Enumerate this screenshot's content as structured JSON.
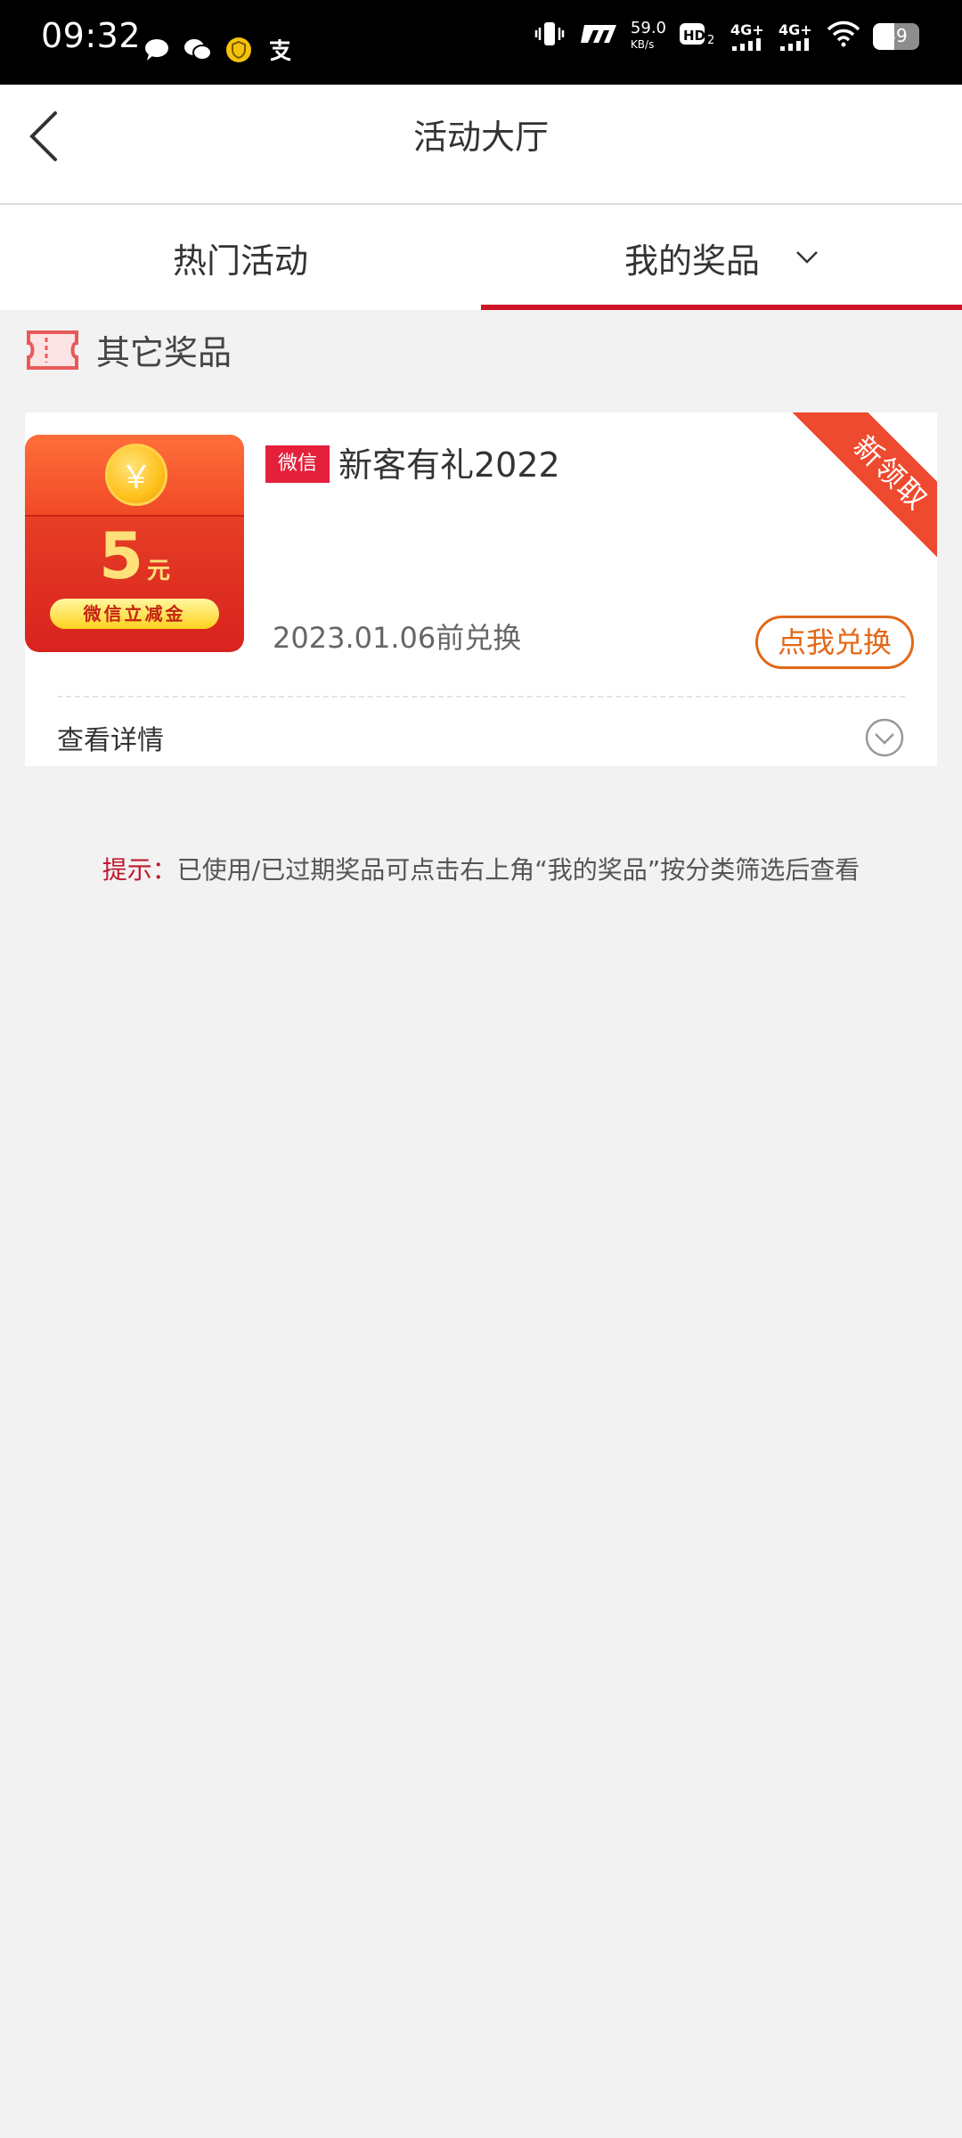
{
  "status_bar": {
    "time": "09:32",
    "speed_value": "59.0",
    "speed_unit": "KB/s",
    "network_1": "4G+",
    "network_2": "4G+",
    "battery": "49"
  },
  "header": {
    "title": "活动大厅"
  },
  "tabs": [
    {
      "label": "热门活动",
      "active": false
    },
    {
      "label": "我的奖品",
      "active": true
    }
  ],
  "section": {
    "title": "其它奖品"
  },
  "prize": {
    "coin_symbol": "￥",
    "amount": "5",
    "amount_unit": "元",
    "pill_text": "微信立减金",
    "platform_badge": "微信",
    "name": "新客有礼2022",
    "deadline": "2023.01.06前兑换",
    "redeem_label": "点我兑换",
    "ribbon_text": "新领取",
    "details_label": "查看详情"
  },
  "hint": {
    "prefix": "提示：",
    "text": "已使用/已过期奖品可点击右上角“我的奖品”按分类筛选后查看"
  },
  "colors": {
    "accent_red": "#cc1426",
    "redeem_orange": "#e36817",
    "ribbon": "#ee4a2f",
    "background": "#f2f2f2"
  }
}
